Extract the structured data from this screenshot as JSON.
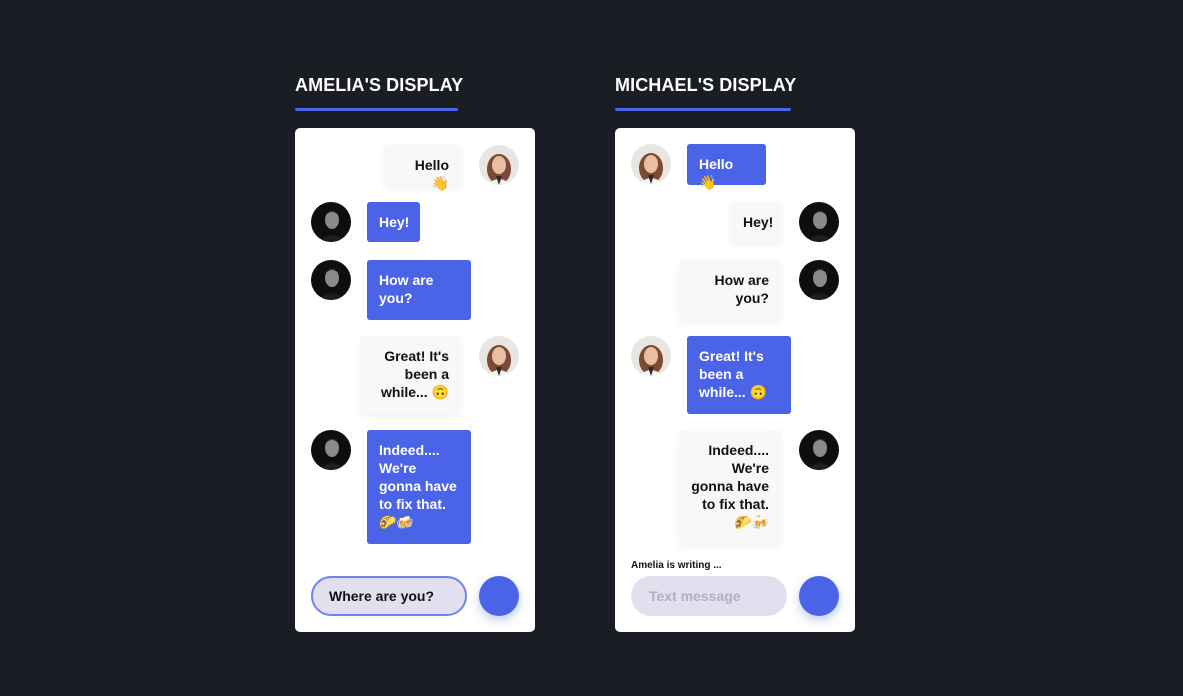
{
  "amelia_display": {
    "title": "AMELIA'S DISPLAY",
    "messages": [
      {
        "sender": "Amelia",
        "text": "Hello 👋"
      },
      {
        "sender": "Michael",
        "text": "Hey!"
      },
      {
        "sender": "Michael",
        "text": "How are you?"
      },
      {
        "sender": "Amelia",
        "text": "Great! It's been a while... 🙃"
      },
      {
        "sender": "Michael",
        "text": "Indeed.... We're gonna have to fix that. 🌮🍻"
      }
    ],
    "input_value": "Where are you?"
  },
  "michael_display": {
    "title": "MICHAEL'S DISPLAY",
    "messages": [
      {
        "sender": "Amelia",
        "text": "Hello 👋"
      },
      {
        "sender": "Michael",
        "text": "Hey!"
      },
      {
        "sender": "Michael",
        "text": "How are you?"
      },
      {
        "sender": "Amelia",
        "text": "Great! It's been a while... 🙃"
      },
      {
        "sender": "Michael",
        "text": "Indeed.... We're gonna have to fix that. 🌮🍻"
      }
    ],
    "typing_indicator": "Amelia is writing ...",
    "input_placeholder": "Text message"
  },
  "colors": {
    "background": "#1b1d24",
    "accent": "#4b63e6",
    "card": "#ffffff",
    "input_bg": "#e2e0ef"
  }
}
